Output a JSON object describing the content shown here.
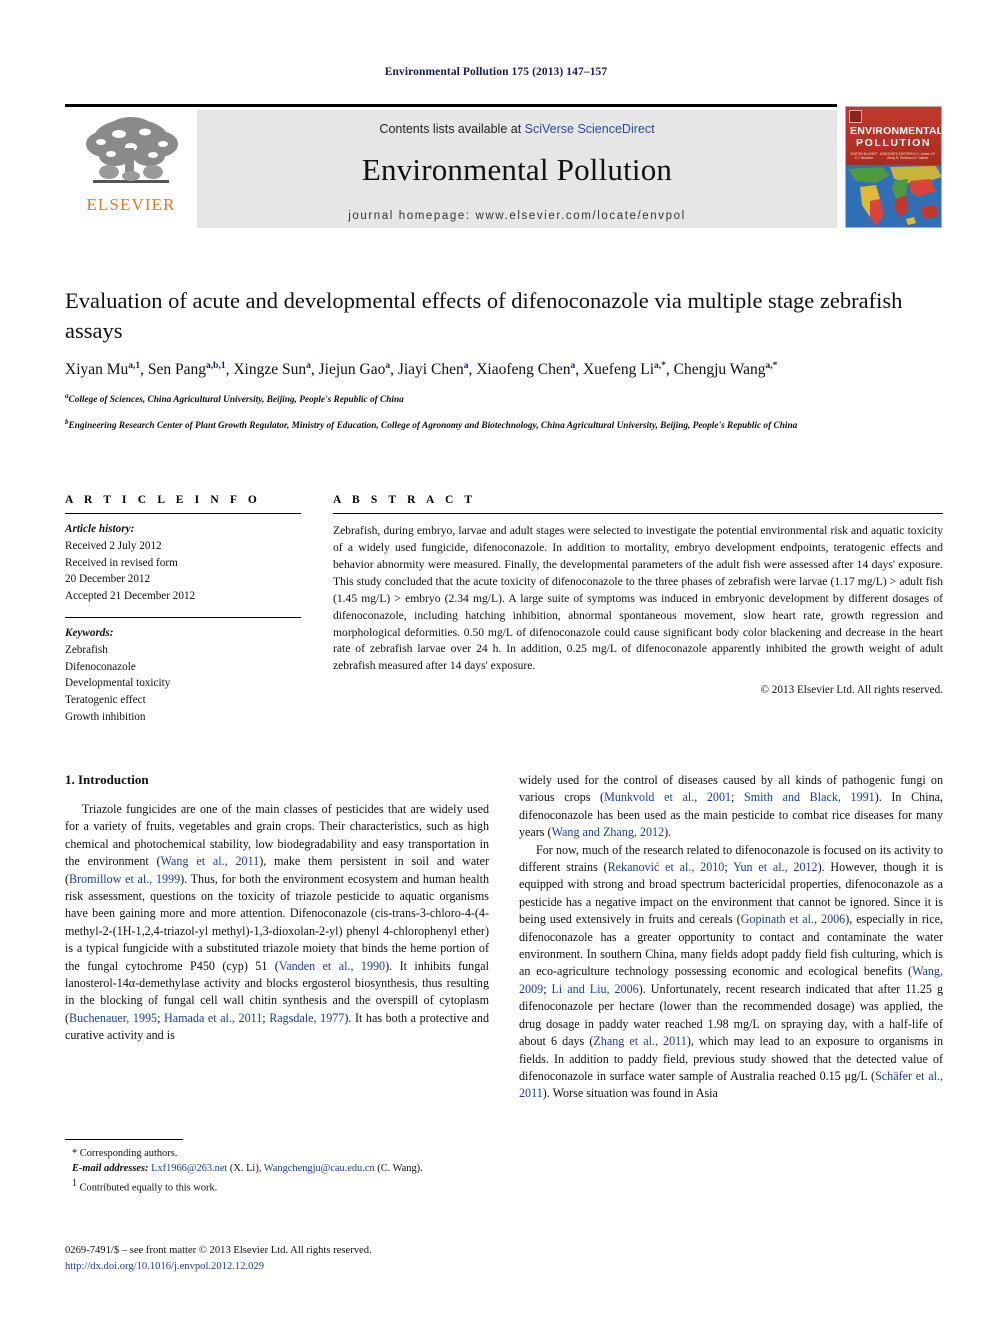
{
  "running_head": "Environmental Pollution 175 (2013) 147–157",
  "masthead": {
    "publisher_word": "ELSEVIER",
    "contents_prefix": "Contents lists available at ",
    "contents_link": "SciVerse ScienceDirect",
    "journal_name": "Environmental Pollution",
    "homepage": "journal homepage: www.elsevier.com/locate/envpol"
  },
  "cover": {
    "line1": "ENVIRONMENTAL",
    "line2": "POLLUTION",
    "editor_block_left": "EDITOR-IN-CHIEF\nE.J. Buecher",
    "editor_block_right": "ASSOCIATE EDITORS\nK.C. Jones   J.P. Giesy\nR. Robinson   D. Sarkar"
  },
  "article": {
    "title": "Evaluation of acute and developmental effects of difenoconazole via multiple stage zebrafish assays",
    "authors_html": "Xiyan Mu<sup>a,1</sup>, Sen Pang<sup>a,b,1</sup>, Xingze Sun<sup>a</sup>, Jiejun Gao<sup>a</sup>, Jiayi Chen<sup>a</sup>, Xiaofeng Chen<sup>a</sup>, Xuefeng Li<sup>a,*</sup>, Chengju Wang<sup>a,*</sup>",
    "affiliation_a": "College of Sciences, China Agricultural University, Beijing, People's Republic of China",
    "affiliation_b": "Engineering Research Center of Plant Growth Regulator, Ministry of Education, College of Agronomy and Biotechnology, China Agricultural University, Beijing, People's Republic of China"
  },
  "article_info": {
    "heading": "A R T I C L E   I N F O",
    "history_label": "Article history:",
    "history": [
      "Received 2 July 2012",
      "Received in revised form",
      "20 December 2012",
      "Accepted 21 December 2012"
    ],
    "keywords_label": "Keywords:",
    "keywords": [
      "Zebrafish",
      "Difenoconazole",
      "Developmental toxicity",
      "Teratogenic effect",
      "Growth inhibition"
    ]
  },
  "abstract": {
    "heading": "A B S T R A C T",
    "text": "Zebrafish, during embryo, larvae and adult stages were selected to investigate the potential environmental risk and aquatic toxicity of a widely used fungicide, difenoconazole. In addition to mortality, embryo development endpoints, teratogenic effects and behavior abnormity were measured. Finally, the developmental parameters of the adult fish were assessed after 14 days' exposure. This study concluded that the acute toxicity of difenoconazole to the three phases of zebrafish were larvae (1.17 mg/L) > adult fish (1.45 mg/L) > embryo (2.34 mg/L). A large suite of symptoms was induced in embryonic development by different dosages of difenoconazole, including hatching inhibition, abnormal spontaneous movement, slow heart rate, growth regression and morphological deformities. 0.50 mg/L of difenoconazole could cause significant body color blackening and decrease in the heart rate of zebrafish larvae over 24 h. In addition, 0.25 mg/L of difenoconazole apparently inhibited the growth weight of adult zebrafish measured after 14 days' exposure.",
    "copyright": "© 2013 Elsevier Ltd. All rights reserved."
  },
  "body": {
    "section_heading": "1. Introduction",
    "left_paragraph_1_html": "Triazole fungicides are one of the main classes of pesticides that are widely used for a variety of fruits, vegetables and grain crops. Their characteristics, such as high chemical and photochemical stability, low biodegradability and easy transportation in the environment (<span class=\"cit\">Wang et al., 2011</span>), make them persistent in soil and water (<span class=\"cit\">Bromillow et al., 1999</span>). Thus, for both the environment ecosystem and human health risk assessment, questions on the toxicity of triazole pesticide to aquatic organisms have been gaining more and more attention. Difenoconazole (cis-trans-3-chloro-4-(4-methyl-2-(1H-1,2,4-triazol-yl methyl)-1,3-dioxolan-2-yl) phenyl 4-chlorophenyl ether) is a typical fungicide with a substituted triazole moiety that binds the heme portion of the fungal cytochrome P450 (cyp) 51 (<span class=\"cit\">Vanden et al., 1990</span>). It inhibits fungal lanosterol-14α-demethylase activity and blocks ergosterol biosynthesis, thus resulting in the blocking of fungal cell wall chitin synthesis and the overspill of cytoplasm (<span class=\"cit\">Buchenauer, 1995</span>; <span class=\"cit\">Hamada et al., 2011</span>; <span class=\"cit\">Ragsdale, 1977</span>). It has both a protective and curative activity and is",
    "right_paragraph_1_html": "widely used for the control of diseases caused by all kinds of pathogenic fungi on various crops (<span class=\"cit\">Munkvold et al., 2001</span>; <span class=\"cit\">Smith and Black, 1991</span>). In China, difenoconazole has been used as the main pesticide to combat rice diseases for many years (<span class=\"cit\">Wang and Zhang, 2012</span>).",
    "right_paragraph_2_html": "For now, much of the research related to difenoconazole is focused on its activity to different strains (<span class=\"cit\">Rekanović et al., 2010</span>; <span class=\"cit\">Yun et al., 2012</span>). However, though it is equipped with strong and broad spectrum bactericidal properties, difenoconazole as a pesticide has a negative impact on the environment that cannot be ignored. Since it is being used extensively in fruits and cereals (<span class=\"cit\">Gopinath et al., 2006</span>), especially in rice, difenoconazole has a greater opportunity to contact and contaminate the water environment. In southern China, many fields adopt paddy field fish culturing, which is an eco-agriculture technology possessing economic and ecological benefits (<span class=\"cit\">Wang, 2009</span>; <span class=\"cit\">Li and Liu, 2006</span>). Unfortunately, recent research indicated that after 11.25 g difenoconazole per hectare (lower than the recommended dosage) was applied, the drug dosage in paddy water reached 1.98 mg/L on spraying day, with a half-life of about 6 days (<span class=\"cit\">Zhang et al., 2011</span>), which may lead to an exposure to organisms in fields. In addition to paddy field, previous study showed that the detected value of difenoconazole in surface water sample of Australia reached 0.15 μg/L (<span class=\"cit\">Schäfer et al., 2011</span>). Worse situation was found in Asia"
  },
  "footnotes": {
    "corresponding": "* Corresponding authors.",
    "email_label": "E-mail addresses:",
    "email_1": "Lxf1966@263.net",
    "email_1_who": " (X. Li), ",
    "email_2": "Wangchengju@cau.edu.cn",
    "email_2_who": " (C. Wang).",
    "equal_contrib_mark": "1",
    "equal_contrib": "Contributed equally to this work."
  },
  "imprint": {
    "line1": "0269-7491/$ – see front matter © 2013 Elsevier Ltd. All rights reserved.",
    "doi": "http://dx.doi.org/10.1016/j.envpol.2012.12.029"
  },
  "colors": {
    "elsevier_orange": "#E87722",
    "link_blue": "#1a3f9e",
    "running_head_navy": "#1a1a5e",
    "band_gray": "#e6e6e6",
    "cover_red": "#c0392b"
  }
}
